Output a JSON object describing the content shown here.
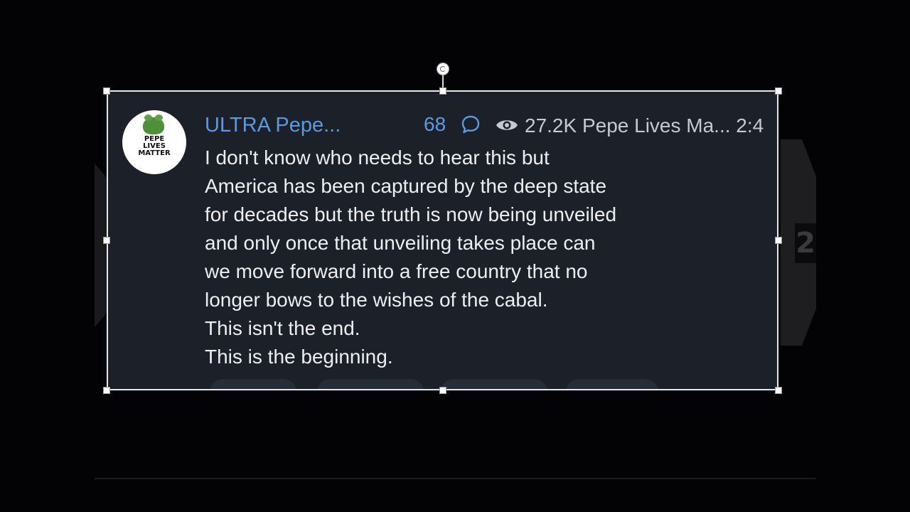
{
  "post": {
    "channel_name": "ULTRA Pepe...",
    "avatar_label": [
      "PEPE",
      "LIVES",
      "MATTER"
    ],
    "comment_count": "68",
    "meta": "27.2K Pepe Lives Ma... 2:4",
    "message_lines": [
      "I don't know who needs to hear this but",
      "America has been captured by the deep state",
      "for decades but the truth is now being unveiled",
      "and only once that unveiling takes place can",
      "we move forward into a free country that no",
      "longer bows to the wishes of the cabal.",
      "This isn't the end.",
      "This is the beginning."
    ]
  },
  "background_badge": "2",
  "colors": {
    "card_bg": "#1c2029",
    "accent_blue": "#5a9be0",
    "text": "#eceef2",
    "meta_text": "#c5c9d1"
  },
  "icons": [
    "comment-icon",
    "eye-icon",
    "rotate-icon"
  ]
}
